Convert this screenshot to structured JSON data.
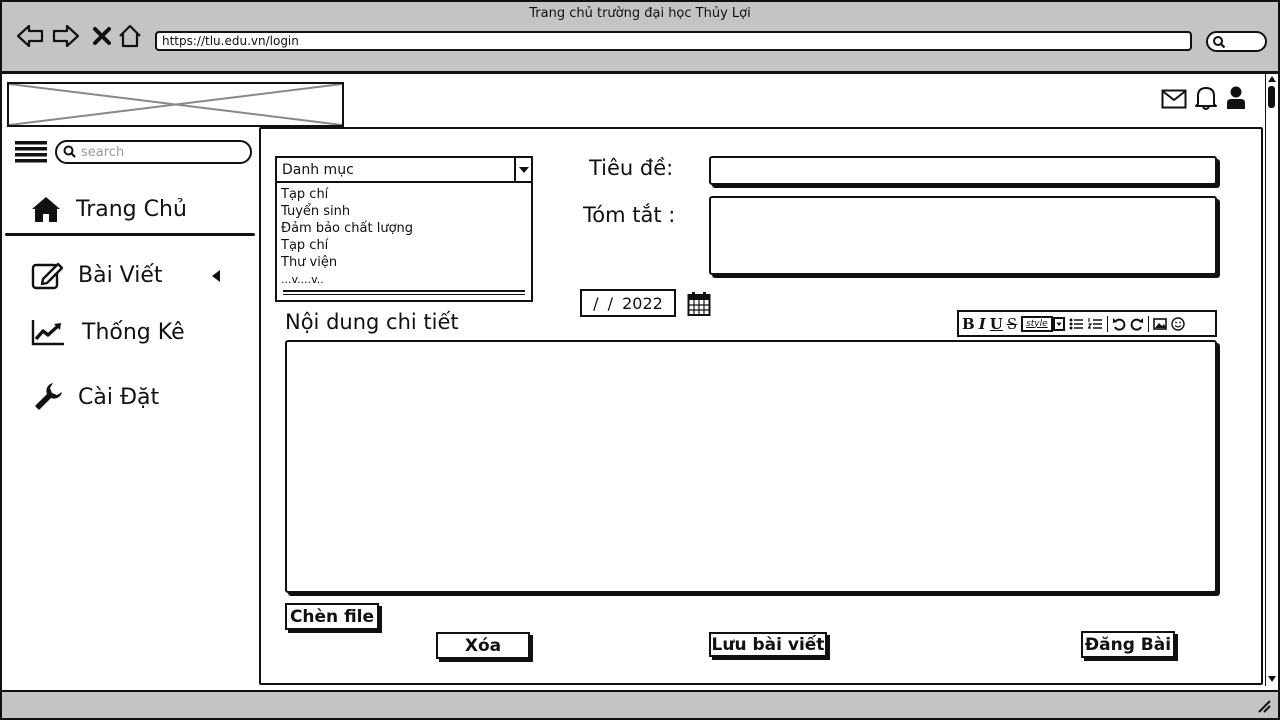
{
  "browser": {
    "window_title": "Trang chủ trường đại học Thủy Lợi",
    "url": "https://tlu.edu.vn/login"
  },
  "sidebar": {
    "search_placeholder": "search",
    "items": [
      {
        "label": "Trang Chủ",
        "icon": "home-icon"
      },
      {
        "label": "Bài Viết",
        "icon": "edit-icon"
      },
      {
        "label": "Thống Kê",
        "icon": "chart-line-icon"
      },
      {
        "label": "Cài Đặt",
        "icon": "wrench-icon"
      }
    ]
  },
  "form": {
    "category": {
      "selected": "Danh mục",
      "options": [
        "Tạp chí",
        "Tuyển sinh",
        "Đảm bảo chất lượng",
        "Tạp chí",
        "Thư viện",
        "...v....v.."
      ]
    },
    "title_label": "Tiêu đề:",
    "summary_label": "Tóm tắt :",
    "date_value": " /  / 2022",
    "content_label": "Nội dung chi tiết",
    "toolbar": {
      "bold": "B",
      "italic": "I",
      "underline": "U",
      "strike": "S",
      "style": "style"
    },
    "attach_label": "Chèn file",
    "delete_label": "Xóa",
    "save_label": "Lưu bài viết",
    "publish_label": "Đăng Bài"
  }
}
